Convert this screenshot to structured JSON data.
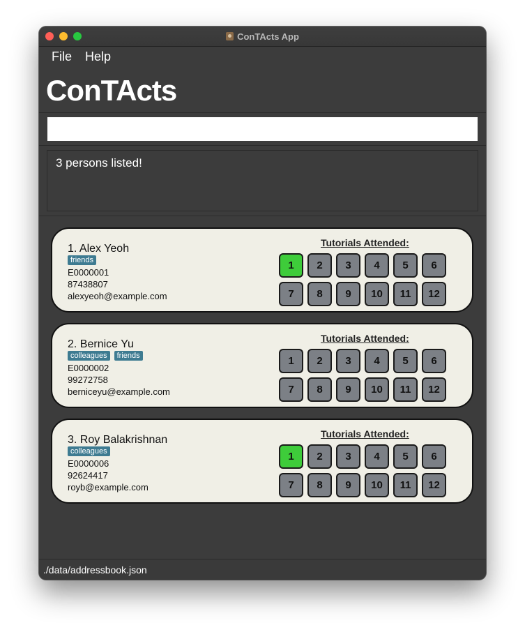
{
  "window": {
    "title": "ConTActs App"
  },
  "menu": {
    "file": "File",
    "help": "Help"
  },
  "brand": "ConTActs",
  "command": {
    "value": "",
    "placeholder": ""
  },
  "result": {
    "text": "3 persons listed!"
  },
  "tutorials_label": "Tutorials Attended:",
  "persons": [
    {
      "display_name": "1. Alex Yeoh",
      "tags": [
        "friends"
      ],
      "student_id": "E0000001",
      "phone": "87438807",
      "email": "alexyeoh@example.com",
      "attended": [
        1
      ]
    },
    {
      "display_name": "2. Bernice Yu",
      "tags": [
        "colleagues",
        "friends"
      ],
      "student_id": "E0000002",
      "phone": "99272758",
      "email": "berniceyu@example.com",
      "attended": []
    },
    {
      "display_name": "3. Roy Balakrishnan",
      "tags": [
        "colleagues"
      ],
      "student_id": "E0000006",
      "phone": "92624417",
      "email": "royb@example.com",
      "attended": [
        1
      ]
    }
  ],
  "tutorial_numbers": [
    "1",
    "2",
    "3",
    "4",
    "5",
    "6",
    "7",
    "8",
    "9",
    "10",
    "11",
    "12"
  ],
  "status": {
    "path": "./data/addressbook.json"
  },
  "colors": {
    "attended": "#3ecc3a",
    "not_attended": "#7c8086",
    "tag": "#3e7b91",
    "card": "#f0efe6",
    "background": "#3c3c3c"
  }
}
